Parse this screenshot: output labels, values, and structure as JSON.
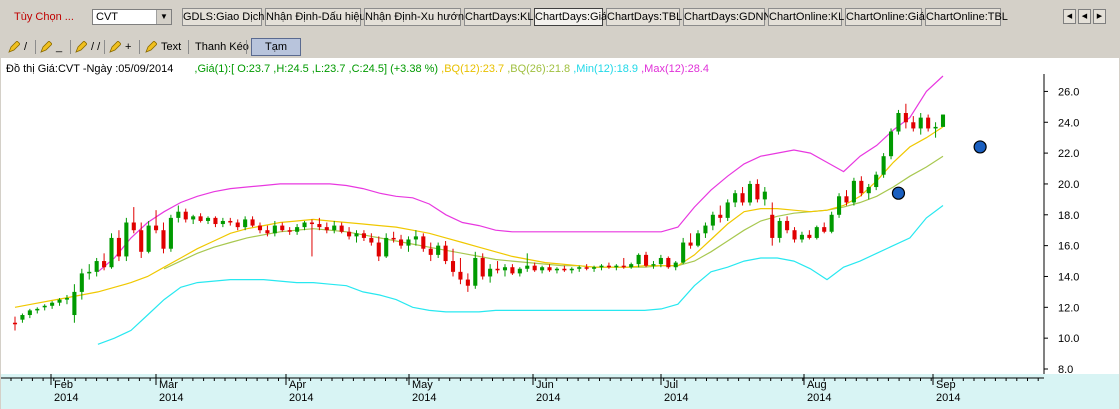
{
  "toolbar": {
    "options_label": "Tùy Chọn ...",
    "symbol": "CVT",
    "buttons": [
      "GDLS:Giao Dịch",
      "Nhận Định-Dấu hiệu",
      "Nhận Định-Xu hướng",
      "ChartDays:KL",
      "ChartDays:Giá",
      "ChartDays:TBL",
      "ChartDays:GDNN",
      "ChartOnline:KL",
      "ChartOnline:Giá",
      "ChartOnline:TBL"
    ],
    "active_button": "ChartDays:Giá"
  },
  "drawing_tools": {
    "text_label": "Text",
    "drag_label": "Thanh Kéo",
    "pause_label": "Tạm Khóp"
  },
  "chart_info": {
    "title": "Đồ thị Giá:CVT -Ngày :05/09/2014",
    "price": ",Giá(1):[",
    "open": " O:23.7",
    "high": " ,H:24.5",
    "low": " ,L:23.7",
    "close": " ,C:24.5]",
    "change": " (+3.38 %)",
    "bq12": " ,BQ(12):23.7",
    "bq26": " ,BQ(26):21.8",
    "min12": " ,Min(12):18.9",
    "max12": " ,Max(12):28.4"
  },
  "colors": {
    "up": "#009a00",
    "down": "#e00000",
    "bq12": "#f0c800",
    "bq26": "#a8c850",
    "min": "#28e8f0",
    "max": "#e838e0",
    "marker": "#1a5fc0",
    "bottom_band": "#d8f4f4"
  },
  "chart_data": {
    "type": "line",
    "ylim": [
      8,
      27
    ],
    "yticks": [
      "26.0",
      "24.0",
      "22.0",
      "20.0",
      "18.0",
      "16.0",
      "14.0",
      "12.0",
      "10.0",
      "8.0"
    ],
    "xticks": [
      {
        "month": "Feb",
        "year": "2014"
      },
      {
        "month": "Mar",
        "year": "2014"
      },
      {
        "month": "Apr",
        "year": "2014"
      },
      {
        "month": "May",
        "year": "2014"
      },
      {
        "month": "Jun",
        "year": "2014"
      },
      {
        "month": "Jul",
        "year": "2014"
      },
      {
        "month": "Aug",
        "year": "2014"
      },
      {
        "month": "Sep",
        "year": "2014"
      }
    ],
    "candles": [
      [
        11.0,
        11.4,
        10.5,
        10.9
      ],
      [
        11.2,
        11.6,
        11.0,
        11.5
      ],
      [
        11.5,
        11.9,
        11.3,
        11.8
      ],
      [
        11.8,
        12.0,
        11.6,
        11.9
      ],
      [
        12.0,
        12.2,
        11.8,
        12.1
      ],
      [
        12.1,
        12.4,
        11.9,
        12.3
      ],
      [
        12.3,
        12.6,
        12.1,
        12.5
      ],
      [
        12.5,
        12.8,
        12.2,
        12.6
      ],
      [
        11.5,
        13.5,
        11.0,
        13.0
      ],
      [
        13.0,
        14.5,
        12.5,
        14.2
      ],
      [
        14.2,
        14.8,
        13.8,
        14.3
      ],
      [
        14.3,
        15.2,
        14.0,
        15.0
      ],
      [
        15.0,
        15.5,
        14.4,
        14.6
      ],
      [
        14.6,
        16.8,
        14.5,
        16.5
      ],
      [
        16.5,
        17.0,
        15.0,
        15.3
      ],
      [
        15.3,
        17.8,
        15.0,
        17.5
      ],
      [
        17.5,
        18.5,
        16.8,
        17.0
      ],
      [
        17.0,
        17.5,
        15.2,
        15.6
      ],
      [
        15.6,
        17.6,
        15.5,
        17.3
      ],
      [
        17.3,
        18.3,
        16.8,
        17.0
      ],
      [
        17.0,
        17.5,
        15.5,
        15.8
      ],
      [
        15.8,
        18.0,
        15.6,
        17.8
      ],
      [
        17.8,
        18.6,
        17.5,
        18.2
      ],
      [
        18.2,
        18.4,
        17.5,
        17.7
      ],
      [
        17.7,
        18.0,
        17.4,
        17.9
      ],
      [
        17.9,
        18.1,
        17.5,
        17.6
      ],
      [
        17.6,
        17.9,
        17.4,
        17.8
      ],
      [
        17.8,
        17.9,
        17.2,
        17.4
      ],
      [
        17.4,
        17.8,
        17.2,
        17.6
      ],
      [
        17.6,
        17.8,
        17.3,
        17.5
      ],
      [
        17.5,
        17.7,
        17.0,
        17.2
      ],
      [
        17.2,
        17.9,
        17.0,
        17.7
      ],
      [
        17.7,
        17.9,
        17.2,
        17.3
      ],
      [
        17.3,
        17.5,
        16.8,
        17.0
      ],
      [
        17.0,
        17.3,
        16.6,
        16.8
      ],
      [
        16.8,
        17.6,
        16.6,
        17.3
      ],
      [
        17.3,
        17.5,
        16.9,
        17.0
      ],
      [
        17.0,
        17.2,
        16.7,
        16.9
      ],
      [
        16.9,
        17.4,
        16.7,
        17.2
      ],
      [
        17.2,
        17.6,
        17.0,
        17.5
      ],
      [
        17.5,
        17.7,
        15.3,
        17.4
      ],
      [
        17.4,
        17.8,
        17.0,
        17.2
      ],
      [
        17.2,
        17.5,
        16.8,
        17.0
      ],
      [
        17.0,
        17.6,
        16.8,
        17.3
      ],
      [
        17.3,
        17.5,
        16.8,
        16.9
      ],
      [
        16.9,
        17.2,
        16.4,
        16.6
      ],
      [
        16.6,
        17.0,
        16.2,
        16.8
      ],
      [
        16.8,
        17.0,
        16.3,
        16.5
      ],
      [
        16.5,
        16.8,
        16.0,
        16.2
      ],
      [
        16.2,
        16.6,
        15.0,
        15.3
      ],
      [
        15.3,
        16.8,
        15.2,
        16.5
      ],
      [
        16.5,
        16.9,
        16.2,
        16.4
      ],
      [
        16.4,
        16.7,
        15.8,
        16.0
      ],
      [
        16.0,
        16.6,
        15.6,
        16.4
      ],
      [
        16.4,
        17.0,
        16.0,
        16.6
      ],
      [
        16.6,
        16.8,
        15.6,
        15.8
      ],
      [
        15.8,
        16.2,
        15.0,
        15.4
      ],
      [
        15.4,
        16.2,
        15.2,
        16.0
      ],
      [
        16.0,
        16.3,
        14.8,
        15.0
      ],
      [
        15.0,
        15.8,
        14.0,
        14.3
      ],
      [
        14.3,
        15.2,
        13.5,
        13.8
      ],
      [
        13.8,
        14.2,
        13.0,
        13.4
      ],
      [
        13.4,
        15.6,
        13.2,
        15.2
      ],
      [
        15.2,
        15.5,
        13.8,
        14.0
      ],
      [
        14.0,
        14.8,
        13.6,
        14.5
      ],
      [
        14.5,
        15.0,
        14.2,
        14.4
      ],
      [
        14.4,
        14.8,
        14.0,
        14.6
      ],
      [
        14.6,
        14.8,
        14.1,
        14.2
      ],
      [
        14.2,
        14.6,
        14.0,
        14.5
      ],
      [
        14.5,
        15.5,
        14.3,
        14.7
      ],
      [
        14.7,
        14.9,
        14.3,
        14.4
      ],
      [
        14.4,
        14.7,
        14.2,
        14.6
      ],
      [
        14.6,
        14.8,
        14.3,
        14.4
      ],
      [
        14.4,
        14.6,
        14.2,
        14.5
      ],
      [
        14.5,
        14.7,
        14.3,
        14.4
      ],
      [
        14.4,
        14.6,
        14.2,
        14.5
      ],
      [
        14.5,
        14.7,
        14.3,
        14.6
      ],
      [
        14.6,
        14.8,
        14.4,
        14.5
      ],
      [
        14.5,
        14.7,
        14.3,
        14.6
      ],
      [
        14.6,
        14.8,
        14.4,
        14.7
      ],
      [
        14.7,
        14.9,
        14.5,
        14.6
      ],
      [
        14.6,
        14.8,
        14.4,
        14.7
      ],
      [
        14.7,
        15.2,
        14.5,
        14.6
      ],
      [
        14.6,
        14.9,
        14.5,
        14.8
      ],
      [
        14.8,
        15.5,
        14.6,
        15.4
      ],
      [
        15.4,
        15.6,
        14.6,
        14.7
      ],
      [
        14.7,
        15.0,
        14.5,
        14.8
      ],
      [
        14.8,
        15.4,
        14.6,
        15.2
      ],
      [
        15.2,
        15.3,
        14.5,
        14.6
      ],
      [
        14.6,
        15.0,
        14.4,
        14.9
      ],
      [
        14.9,
        16.5,
        14.8,
        16.2
      ],
      [
        16.2,
        16.8,
        15.8,
        16.0
      ],
      [
        16.0,
        17.0,
        15.9,
        16.8
      ],
      [
        16.8,
        17.5,
        16.5,
        17.3
      ],
      [
        17.3,
        18.2,
        17.0,
        18.0
      ],
      [
        18.0,
        18.6,
        17.5,
        17.8
      ],
      [
        17.8,
        19.0,
        17.6,
        18.8
      ],
      [
        18.8,
        19.6,
        18.5,
        19.4
      ],
      [
        19.4,
        19.8,
        18.6,
        18.8
      ],
      [
        18.8,
        20.2,
        18.6,
        20.0
      ],
      [
        20.0,
        20.3,
        18.8,
        19.0
      ],
      [
        19.0,
        19.8,
        18.6,
        19.5
      ],
      [
        18.0,
        18.8,
        16.0,
        16.5
      ],
      [
        16.5,
        17.8,
        16.2,
        17.6
      ],
      [
        17.6,
        17.9,
        16.8,
        17.0
      ],
      [
        17.0,
        17.2,
        16.2,
        16.4
      ],
      [
        16.4,
        16.9,
        16.2,
        16.7
      ],
      [
        16.7,
        17.0,
        16.4,
        16.5
      ],
      [
        16.5,
        17.3,
        16.4,
        17.2
      ],
      [
        17.2,
        17.5,
        16.8,
        16.9
      ],
      [
        16.9,
        18.2,
        16.8,
        18.0
      ],
      [
        18.0,
        19.4,
        17.8,
        19.2
      ],
      [
        19.2,
        19.6,
        18.6,
        18.8
      ],
      [
        18.8,
        20.4,
        18.6,
        20.2
      ],
      [
        20.2,
        20.5,
        19.2,
        19.4
      ],
      [
        19.4,
        20.0,
        19.0,
        19.8
      ],
      [
        19.8,
        20.8,
        19.6,
        20.6
      ],
      [
        20.6,
        22.0,
        20.4,
        21.8
      ],
      [
        21.8,
        23.6,
        21.6,
        23.4
      ],
      [
        23.4,
        24.8,
        23.2,
        24.6
      ],
      [
        24.6,
        25.2,
        23.6,
        24.0
      ],
      [
        24.0,
        24.4,
        23.4,
        23.6
      ],
      [
        23.6,
        24.6,
        23.2,
        24.3
      ],
      [
        24.3,
        24.5,
        23.4,
        23.6
      ],
      [
        23.6,
        24.0,
        23.0,
        23.7
      ],
      [
        23.7,
        24.5,
        23.7,
        24.5
      ]
    ],
    "bq12": [
      12.0,
      12.2,
      12.4,
      12.6,
      12.8,
      13.0,
      13.3,
      13.6,
      14.0,
      14.6,
      15.2,
      15.8,
      16.3,
      16.8,
      17.1,
      17.3,
      17.5,
      17.6,
      17.7,
      17.6,
      17.5,
      17.4,
      17.3,
      17.2,
      17.0,
      16.8,
      16.5,
      16.2,
      15.9,
      15.6,
      15.3,
      15.1,
      14.9,
      14.8,
      14.7,
      14.6,
      14.6,
      14.6,
      14.7,
      14.7,
      14.7,
      15.4,
      16.4,
      17.4,
      18.2,
      18.4,
      18.4,
      18.3,
      18.2,
      18.3,
      18.6,
      19.2,
      20.2,
      21.4,
      22.4,
      23.0,
      23.7
    ],
    "bq26": [
      null,
      null,
      null,
      null,
      null,
      null,
      null,
      null,
      null,
      14.5,
      15.0,
      15.5,
      15.9,
      16.2,
      16.5,
      16.7,
      16.9,
      17.0,
      17.1,
      17.0,
      16.9,
      16.7,
      16.5,
      16.3,
      16.1,
      15.9,
      15.7,
      15.5,
      15.3,
      15.1,
      15.0,
      14.9,
      14.8,
      14.7,
      14.7,
      14.6,
      14.6,
      14.6,
      14.6,
      14.7,
      14.7,
      15.0,
      15.6,
      16.3,
      17.0,
      17.6,
      17.9,
      18.1,
      18.2,
      18.3,
      18.5,
      18.8,
      19.2,
      19.8,
      20.5,
      21.1,
      21.8
    ],
    "min12": [
      null,
      null,
      null,
      null,
      null,
      9.6,
      10.0,
      10.5,
      11.5,
      12.5,
      13.3,
      13.6,
      13.7,
      13.8,
      13.8,
      13.8,
      13.7,
      13.6,
      13.6,
      13.5,
      13.4,
      13.0,
      12.8,
      12.5,
      12.0,
      11.8,
      11.7,
      11.7,
      11.7,
      11.8,
      11.8,
      11.8,
      11.8,
      11.8,
      11.8,
      11.8,
      11.8,
      11.8,
      11.8,
      11.9,
      12.2,
      13.4,
      14.3,
      14.6,
      15.0,
      15.2,
      15.2,
      15.0,
      14.5,
      13.8,
      14.6,
      15.0,
      15.5,
      16.0,
      16.5,
      17.8,
      18.6
    ],
    "max12": [
      null,
      null,
      null,
      null,
      null,
      14.3,
      15.2,
      16.5,
      17.5,
      18.2,
      18.8,
      19.2,
      19.5,
      19.7,
      19.8,
      19.9,
      20.0,
      20.0,
      20.0,
      20.0,
      19.9,
      19.7,
      19.4,
      19.2,
      19.1,
      18.7,
      18.0,
      17.5,
      17.3,
      17.0,
      16.9,
      16.9,
      16.9,
      16.9,
      16.9,
      16.9,
      16.9,
      16.9,
      16.9,
      16.9,
      17.2,
      18.5,
      19.6,
      20.5,
      21.3,
      21.8,
      22.0,
      22.2,
      22.0,
      21.4,
      20.8,
      21.8,
      22.5,
      23.5,
      24.3,
      26.0,
      27.0
    ],
    "markers": [
      {
        "candle": 119,
        "value": 19.4
      },
      {
        "candle": 130,
        "value": 22.4
      }
    ]
  }
}
